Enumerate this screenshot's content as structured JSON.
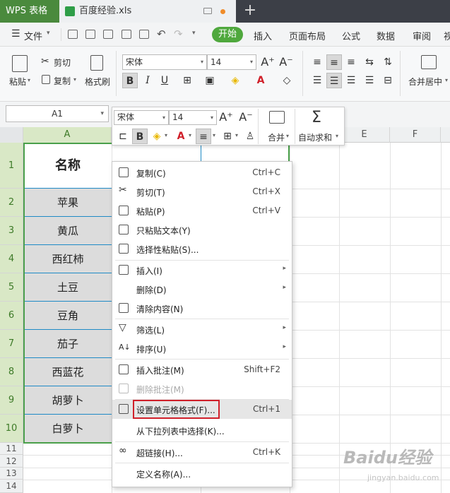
{
  "titlebar": {
    "app_name": "WPS 表格",
    "doc_name": "百度经验.xls",
    "new_tab": "+"
  },
  "menubar": {
    "file_label": "文件",
    "tabs": [
      "开始",
      "插入",
      "页面布局",
      "公式",
      "数据",
      "审阅",
      "视"
    ]
  },
  "ribbon": {
    "paste_label": "粘贴",
    "cut_label": "剪切",
    "copy_label": "复制",
    "format_painter_label": "格式刷",
    "font_name": "宋体",
    "font_size": "14",
    "merge_label": "合并居中"
  },
  "formula": {
    "cell_ref": "A1"
  },
  "minitoolbar": {
    "font_name": "宋体",
    "font_size": "14",
    "merge_label": "合并",
    "autosum_label": "自动求和"
  },
  "columns": [
    "A",
    "E",
    "F"
  ],
  "rows": [
    "1",
    "2",
    "3",
    "4",
    "5",
    "6",
    "7",
    "8",
    "9",
    "10",
    "11",
    "12",
    "13",
    "14"
  ],
  "cells": {
    "header": "名称",
    "items": [
      "苹果",
      "黄瓜",
      "西红柿",
      "土豆",
      "豆角",
      "茄子",
      "西蓝花",
      "胡萝卜",
      "白萝卜"
    ]
  },
  "context_menu": {
    "copy": {
      "label": "复制(C)",
      "shortcut": "Ctrl+C"
    },
    "cut": {
      "label": "剪切(T)",
      "shortcut": "Ctrl+X"
    },
    "paste": {
      "label": "粘贴(P)",
      "shortcut": "Ctrl+V"
    },
    "paste_text": {
      "label": "只粘贴文本(Y)"
    },
    "paste_special": {
      "label": "选择性粘贴(S)..."
    },
    "insert": {
      "label": "插入(I)"
    },
    "delete": {
      "label": "删除(D)"
    },
    "clear": {
      "label": "清除内容(N)"
    },
    "filter": {
      "label": "筛选(L)"
    },
    "sort": {
      "label": "排序(U)"
    },
    "insert_comment": {
      "label": "插入批注(M)",
      "shortcut": "Shift+F2"
    },
    "delete_comment": {
      "label": "删除批注(M)"
    },
    "format_cells": {
      "label": "设置单元格格式(F)...",
      "shortcut": "Ctrl+1"
    },
    "pick_from_list": {
      "label": "从下拉列表中选择(K)..."
    },
    "hyperlink": {
      "label": "超链接(H)...",
      "shortcut": "Ctrl+K"
    },
    "define_name": {
      "label": "定义名称(A)..."
    }
  },
  "watermark": {
    "logo": "Baidu经验",
    "sub": "jingyan.baidu.com"
  },
  "colors": {
    "brand_green": "#4fa83d",
    "highlight_red": "#d0202a",
    "selection_green": "#4aa04a"
  }
}
